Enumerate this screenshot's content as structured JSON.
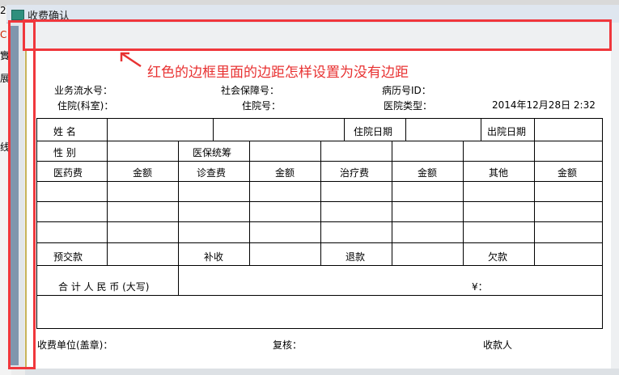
{
  "window": {
    "title": "收费确认"
  },
  "annotation": {
    "text": "红色的边框里面的边距怎样设置为没有边距"
  },
  "background_fragments": [
    "2",
    "C",
    "實",
    "展",
    "线"
  ],
  "header": {
    "serial_label": "业务流水号：",
    "social_label": "社会保障号：",
    "record_label": "病历号ID：",
    "dept_label": "住院(科室)：",
    "inpatient_label": "住院号：",
    "hospital_type_label": "医院类型：",
    "date": "2014年12月28日 2:32"
  },
  "table": {
    "name": "姓  名",
    "admit_date": "住院日期",
    "discharge_date": "出院日期",
    "gender": "性  别",
    "insurance": "医保统筹",
    "medicine": "医药费",
    "amount": "金额",
    "exam": "诊查费",
    "treatment": "治疗费",
    "other": "其他",
    "prepay": "预交款",
    "supplement": "补收",
    "refund": "退款",
    "owed": "欠款",
    "total_rmb": "合 计 人 民 币 (大写)",
    "yuan_sign": "¥："
  },
  "footer": {
    "unit": "收费单位(盖章)：",
    "review": "复核：",
    "cashier": "收款人"
  }
}
